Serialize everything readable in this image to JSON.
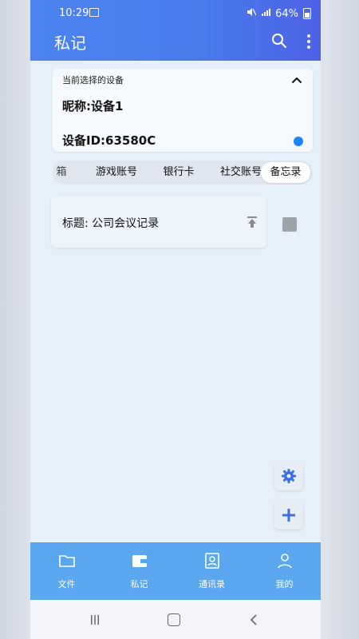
{
  "status_bar": {
    "time": "10:29",
    "battery": "64%"
  },
  "header": {
    "title": "私记"
  },
  "device_card": {
    "label": "当前选择的设备",
    "nickname": "昵称:设备1",
    "device_id": "设备ID:63580C"
  },
  "tabs": [
    {
      "label": "箱"
    },
    {
      "label": "游戏账号"
    },
    {
      "label": "银行卡"
    },
    {
      "label": "社交账号"
    },
    {
      "label": "备忘录",
      "active": true
    }
  ],
  "notes": [
    {
      "title": "标题: 公司会议记录"
    }
  ],
  "bottom_nav": [
    {
      "label": "文件",
      "icon": "folder-icon"
    },
    {
      "label": "私记",
      "icon": "wallet-icon"
    },
    {
      "label": "通讯录",
      "icon": "contacts-icon"
    },
    {
      "label": "我的",
      "icon": "person-icon"
    }
  ],
  "colors": {
    "header": "#4a7bea",
    "bottom_nav": "#5aa7ef",
    "accent_dot": "#1a85ff",
    "fab_icon": "#3b6fe0"
  }
}
